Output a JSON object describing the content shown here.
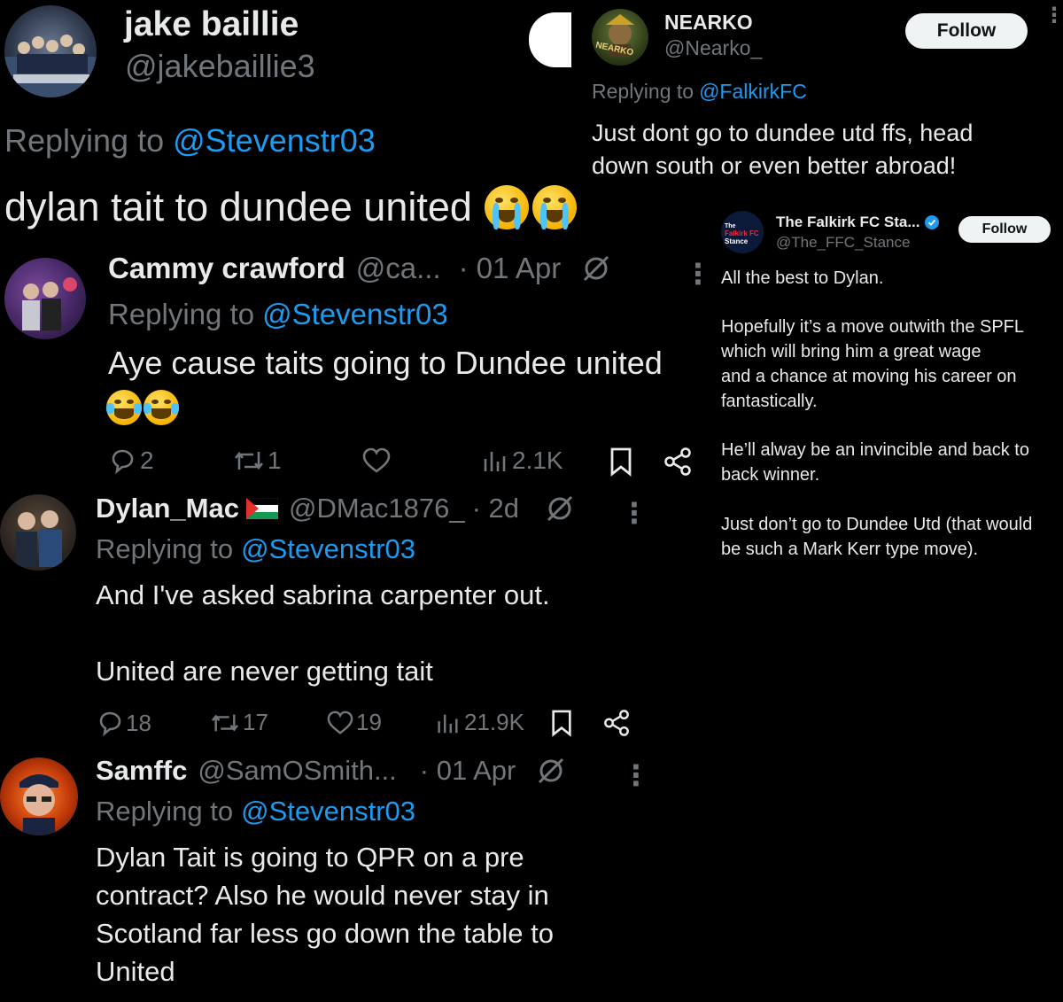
{
  "post1": {
    "name": "jake baillie",
    "handle": "@jakebaillie3",
    "replying_prefix": "Replying to",
    "replying_handle": "@Stevenstr03",
    "text": "dylan tait to dundee united",
    "emoji": "loudly-crying-face x2"
  },
  "post2": {
    "name": "Cammy crawford",
    "handle": "@ca...",
    "date": "· 01 Apr",
    "replying_prefix": "Replying to",
    "replying_handle": "@Stevenstr03",
    "text": "Aye cause taits going to Dundee united",
    "emoji": "tears-of-joy x2",
    "replies": "2",
    "reposts": "1",
    "likes": "",
    "views": "2.1K"
  },
  "post3": {
    "name": "Dylan_Mac",
    "handle": "@DMac1876_",
    "date": "· 2d",
    "replying_prefix": "Replying to",
    "replying_handle": "@Stevenstr03",
    "text": "And I've asked sabrina carpenter out.\n\nUnited are never getting tait",
    "replies": "18",
    "reposts": "17",
    "likes": "19",
    "views": "21.9K"
  },
  "post4": {
    "name": "Samffc",
    "handle": "@SamOSmith...",
    "date": "· 01 Apr",
    "replying_prefix": "Replying to",
    "replying_handle": "@Stevenstr03",
    "text": "Dylan Tait is going to QPR on a pre\ncontract? Also he would never stay in\nScotland far less go down the table to\nUnited"
  },
  "nearko": {
    "name": "NEARKO",
    "handle": "@Nearko_",
    "avatar_text": "NEARKO",
    "follow_label": "Follow",
    "replying_prefix": "Replying to",
    "replying_handle": "@FalkirkFC",
    "text": "Just dont go to dundee utd ffs, head\ndown south or even better abroad!"
  },
  "stance": {
    "name": "The Falkirk FC Sta...",
    "handle": "@The_FFC_Stance",
    "avatar_line1": "The",
    "avatar_line2": "Falkirk FC",
    "avatar_line3": "Stance",
    "follow_label": "Follow",
    "para1": "All the best to Dylan.",
    "para2": "Hopefully it’s a move outwith the SPFL\nwhich will bring him a great wage\nand a chance at moving his career on\nfantastically.",
    "para3": "He’ll alway be an invincible and back to\nback winner.",
    "para4": "Just don’t go to Dundee Utd (that would\nbe such a Mark Kerr type move)."
  },
  "colors": {
    "background": "#000000",
    "text": "#e7e9ea",
    "muted": "#71767b",
    "link": "#1d9bf0",
    "verified": "#1d9bf0"
  }
}
